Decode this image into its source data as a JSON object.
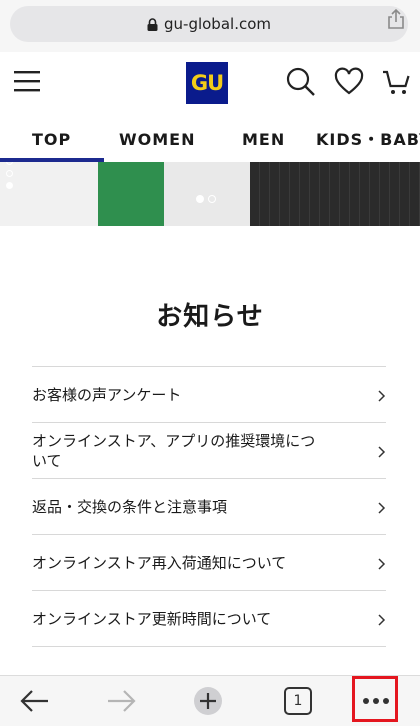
{
  "browser": {
    "url": "gu-global.com",
    "tab_count": "1"
  },
  "header": {
    "logo_text": "GU",
    "brand_colors": {
      "logo_bg": "#0a1b8c",
      "logo_text": "#f3cd19"
    },
    "icons": [
      "menu-icon",
      "search-icon",
      "heart-icon",
      "cart-icon"
    ]
  },
  "tabs": [
    {
      "label": "TOP",
      "active": true
    },
    {
      "label": "WOMEN",
      "active": false
    },
    {
      "label": "MEN",
      "active": false
    },
    {
      "label": "KIDS・BABY",
      "active": false
    }
  ],
  "notice": {
    "title": "お知らせ",
    "items": [
      "お客様の声アンケート",
      "オンラインストア、アプリの推奨環境について",
      "返品・交換の条件と注意事項",
      "オンラインストア再入荷通知について",
      "オンラインストア更新時間について"
    ]
  },
  "colors": {
    "accent": "#1c2a8f",
    "highlight": "#e4161f"
  }
}
